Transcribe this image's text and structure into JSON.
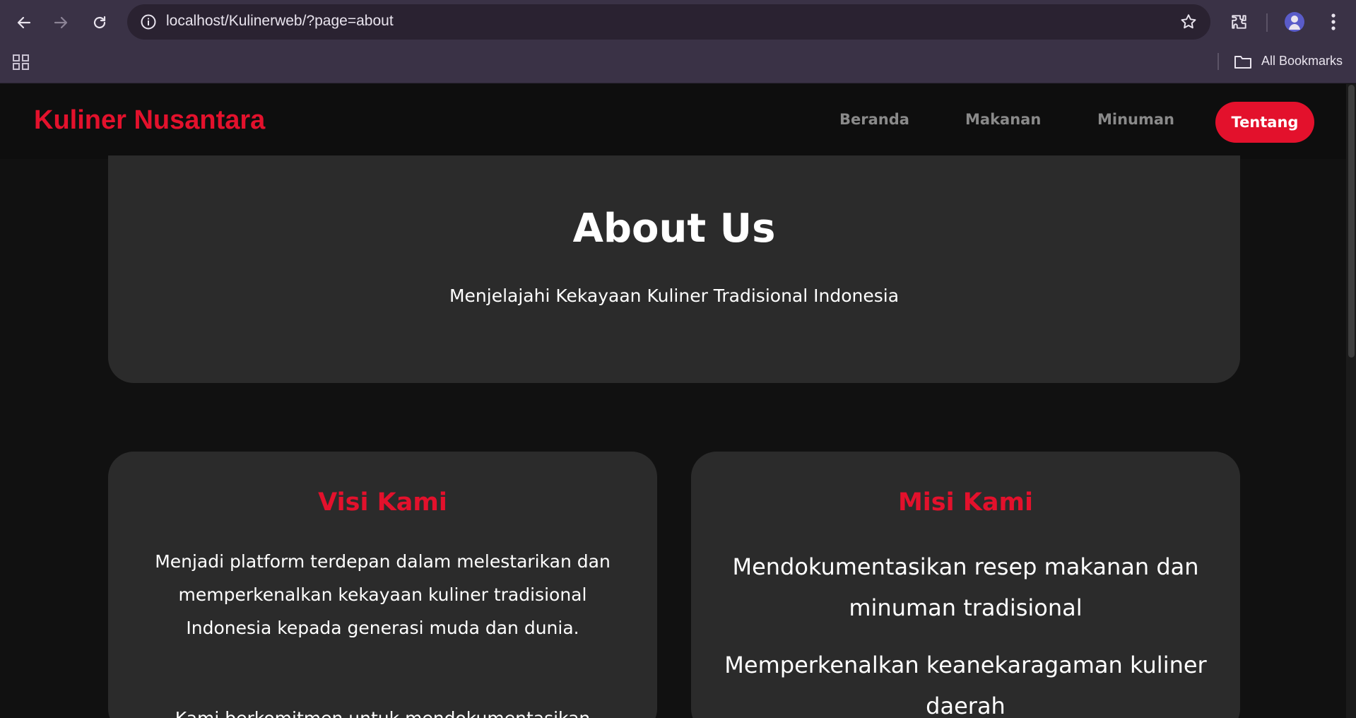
{
  "browser": {
    "url": "localhost/Kulinerweb/?page=about",
    "bookmarks_label": "All Bookmarks"
  },
  "site": {
    "brand": "Kuliner Nusantara",
    "nav": [
      "Beranda",
      "Makanan",
      "Minuman",
      "Tentang"
    ],
    "active_nav": "Tentang",
    "accent_color": "#e3112c"
  },
  "hero": {
    "title": "About Us",
    "subtitle": "Menjelajahi Kekayaan Kuliner Tradisional Indonesia"
  },
  "vision": {
    "title": "Visi Kami",
    "text": "Menjadi platform terdepan dalam melestarikan dan memperkenalkan kekayaan kuliner tradisional Indonesia kepada generasi muda dan dunia.",
    "text2": "Kami berkomitmen untuk mendokumentasikan"
  },
  "mission": {
    "title": "Misi Kami",
    "items": [
      "Mendokumentasikan resep makanan dan minuman tradisional",
      "Memperkenalkan keanekaragaman kuliner daerah"
    ]
  }
}
